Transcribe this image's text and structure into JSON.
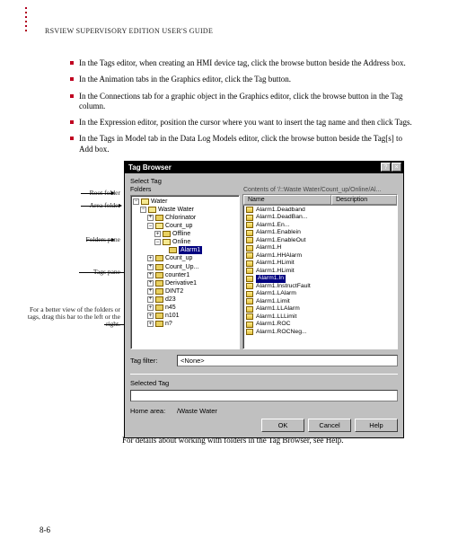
{
  "header": {
    "title": "RSVIEW SUPERVISORY EDITION USER'S GUIDE"
  },
  "bullets": [
    "In the Tags editor, when creating an HMI device tag, click the browse button beside the Address box.",
    "In the Animation tabs in the Graphics editor, click the Tag button.",
    "In the Connections tab for a graphic object in the Graphics editor, click the browse button in the Tag column.",
    "In the Expression editor, position the cursor where you want to insert the tag name and then click Tags.",
    "In the Tags in Model tab in the Data Log Models editor, click the browse button beside the Tag[s] to Add box."
  ],
  "callouts": {
    "root": "Root folder",
    "area": "Area folder",
    "folders": "Folders pane",
    "tags": "Tags pane",
    "drag": "For a better view of the folders or tags, drag this bar to the left or the right."
  },
  "dialog": {
    "title": "Tag Browser",
    "section": "Select Tag",
    "foldersLabel": "Folders",
    "contents": "Contents of '/::Waste Water/Count_up/Online/Al...",
    "col1": "Name",
    "col2": "Description",
    "tree": {
      "root": "Water",
      "area": "Waste Water",
      "items": [
        "Chlorinator",
        "Count_up",
        "Offline",
        "Online"
      ],
      "selected": "Alarm1",
      "more": [
        "Count_up",
        "Count_Up...",
        "counter1",
        "Derivative1",
        "DINT2",
        "d23",
        "n45",
        "n101",
        "n?"
      ]
    },
    "tags": [
      "Alarm1.Deadband",
      "Alarm1.DeadBan...",
      "Alarm1.En...",
      "Alarm1.Enablein",
      "Alarm1.EnableOut",
      "Alarm1.H",
      "Alarm1.HHAlarm",
      "Alarm1.HLimit",
      "Alarm1.HLimit",
      "Alarm1.In",
      "Alarm1.InstructFault",
      "Alarm1.LAlarm",
      "Alarm1.Limit",
      "Alarm1.LLAlarm",
      "Alarm1.LLLimit",
      "Alarm1.ROC",
      "Alarm1.ROCNeg..."
    ],
    "filterLabel": "Tag filter:",
    "filterValue": "<None>",
    "selectedLabel": "Selected Tag",
    "homeLabel": "Home area:",
    "homeValue": "/Waste Water",
    "buttons": {
      "ok": "OK",
      "cancel": "Cancel",
      "help": "Help"
    }
  },
  "caption": "For details about working with folders in the Tag Browser, see Help.",
  "pageNum": "8-6"
}
